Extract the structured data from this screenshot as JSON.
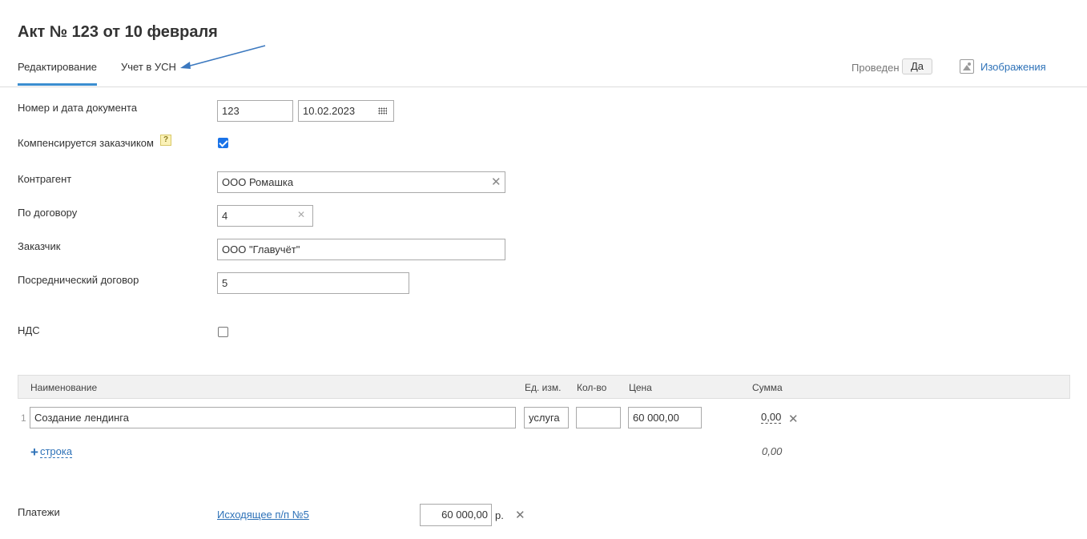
{
  "document": {
    "title": "Акт № 123 от 10 февраля"
  },
  "tabs": [
    {
      "label": "Редактирование",
      "active": true
    },
    {
      "label": "Учет в УСН",
      "active": false
    }
  ],
  "status": {
    "posted_label": "Проведен",
    "posted_value": "Да"
  },
  "images": {
    "label": "Изображения"
  },
  "form": {
    "number_date_label": "Номер и дата документа",
    "number": "123",
    "date": "10.02.2023",
    "compensated_label": "Компенсируется заказчиком",
    "compensated_checked": true,
    "help_symbol": "?",
    "counterparty_label": "Контрагент",
    "counterparty": "ООО Ромашка",
    "contract_label": "По договору",
    "contract": "4",
    "customer_label": "Заказчик",
    "customer": "ООО \"Главучёт\"",
    "agency_contract_label": "Посреднический договор",
    "agency_contract": "5",
    "vat_label": "НДС",
    "vat_checked": false
  },
  "table": {
    "columns": {
      "name": "Наименование",
      "unit": "Ед. изм.",
      "qty": "Кол-во",
      "price": "Цена",
      "sum": "Сумма"
    },
    "rows": [
      {
        "num": "1",
        "name": "Создание лендинга",
        "unit": "услуга",
        "qty": "",
        "price": "60 000,00",
        "sum": "0,00"
      }
    ],
    "add_row_plus": "+",
    "add_row_label": "строка",
    "total": "0,00"
  },
  "payments": {
    "label": "Платежи",
    "link": "Исходящее п/п №5",
    "amount": "60 000,00",
    "currency": "р."
  },
  "icons": {
    "clear": "✕",
    "delete": "✕"
  },
  "colors": {
    "accent": "#3b8ed0",
    "link": "#2e72b8",
    "checkbox": "#1a73e8",
    "arrow": "#3b78bf"
  }
}
